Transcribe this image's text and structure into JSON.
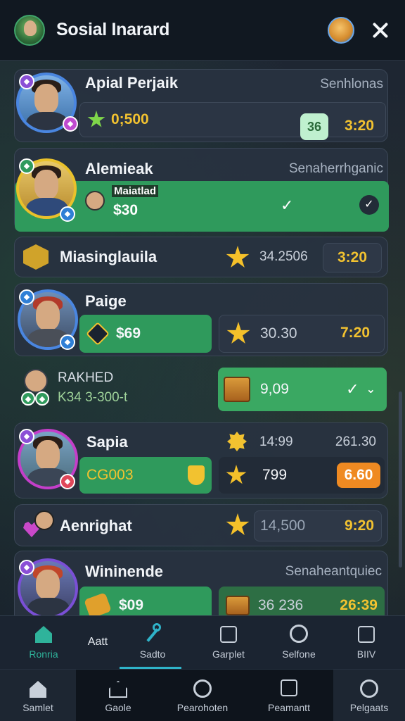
{
  "header": {
    "title": "Sosial Inarard",
    "avatar_icon": "user-avatar-icon",
    "profile_icon": "profile-icon",
    "close_icon": "close-icon"
  },
  "rows": [
    {
      "name": "Apial Perjaik",
      "meta": "Senhlonas",
      "score": "0;500",
      "badge": "36",
      "time": "3:20"
    },
    {
      "name": "Alemieak",
      "meta": "Senaherrhganic",
      "sub_label": "Maiatlad",
      "amount": "$30"
    },
    {
      "name": "Miasinglauila",
      "score": "34.2506",
      "time": "3:20"
    },
    {
      "name": "Paige",
      "amount": "$69",
      "score": "30.30",
      "time": "7:20"
    },
    {
      "name": "RAKHED",
      "sub_label": "K34 3-300-t",
      "score": "9,09"
    },
    {
      "name": "Sapia",
      "meta_left": "14:99",
      "meta_right": "261.30",
      "code": "CG003",
      "score": "799",
      "time": "6.60"
    },
    {
      "name": "Aenrighat",
      "score": "14,500",
      "time": "9:20"
    },
    {
      "name": "Wininende",
      "meta": "Senaheantquiec",
      "amount": "$09",
      "score": "36 236",
      "time": "26:39"
    }
  ],
  "tabs_top": [
    {
      "label": "Ronria",
      "icon": "home-icon"
    },
    {
      "label": "Aatt",
      "icon": ""
    },
    {
      "label": "Sadto",
      "icon": "wand-icon"
    },
    {
      "label": "Garplet",
      "icon": "clipboard-icon"
    },
    {
      "label": "Selfone",
      "icon": "search-icon"
    },
    {
      "label": "BIIV",
      "icon": "clipboard-icon"
    }
  ],
  "tabs_bottom": [
    {
      "label": "Samlet",
      "icon": "home-icon"
    },
    {
      "label": "Gaole",
      "icon": "home-outline-icon"
    },
    {
      "label": "Pearohoten",
      "icon": "circle-icon"
    },
    {
      "label": "Peamantt",
      "icon": "upload-icon"
    },
    {
      "label": "Pelgaats",
      "icon": "clock-icon"
    }
  ],
  "colors": {
    "accent_green": "#2f9a5c",
    "gold": "#f2c230",
    "orange_badge": "#ef8a22",
    "mint_badge": "#bff0cf",
    "active_tab": "#2fb3c9"
  }
}
